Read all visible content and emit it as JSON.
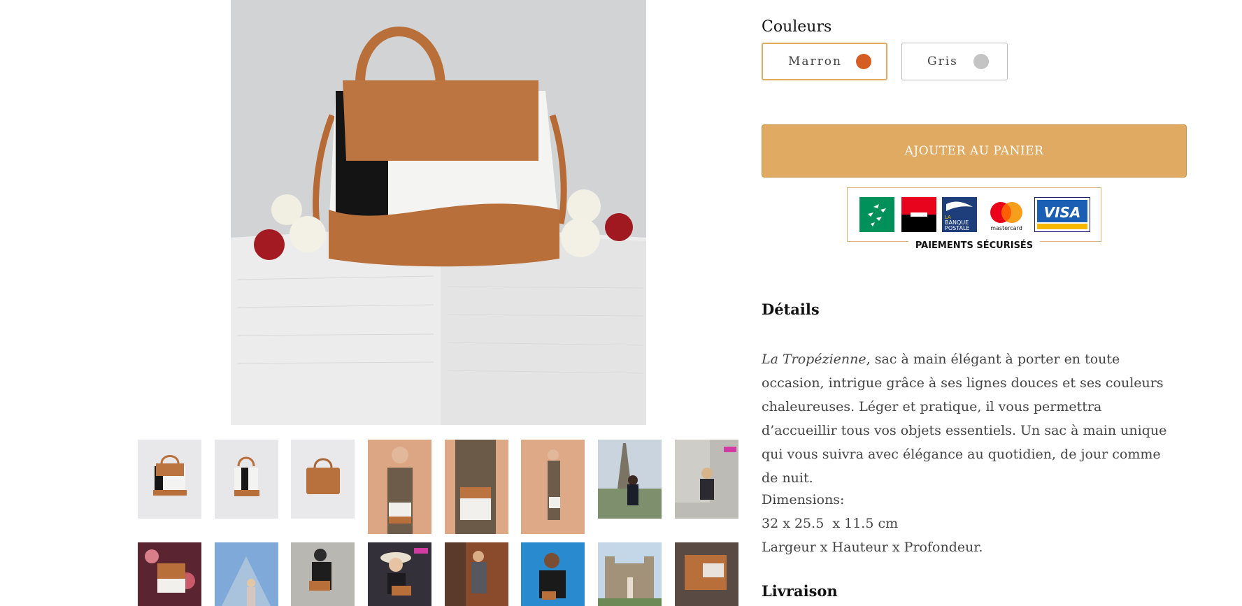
{
  "product": {
    "colors_title": "Couleurs",
    "color_options": [
      {
        "label": "Marron",
        "color": "#d35d22",
        "selected": true
      },
      {
        "label": "Gris",
        "color": "#c4c4c4",
        "selected": false
      }
    ],
    "add_to_cart_label": "AJOUTER AU PANIER",
    "payment_caption": "PAIEMENTS SÉCURISÉS",
    "payment_logos": [
      {
        "name": "bnp-paribas",
        "color": "#00915a"
      },
      {
        "name": "societe-generale",
        "color": "#e9041e"
      },
      {
        "name": "la-banque-postale",
        "text_line1": "LA",
        "text_line2": "BANQUE",
        "text_line3": "POSTALE",
        "color": "#1d3d7b"
      },
      {
        "name": "mastercard",
        "text": "mastercard"
      },
      {
        "name": "visa",
        "text": "VISA",
        "color": "#1a1f71"
      }
    ],
    "details_title": "Détails",
    "description_italic": "La Tropézienne",
    "description_rest": ", sac à main élégant à porter en toute occasion, intrigue grâce à ses lignes douces et ses couleurs chaleureuses. Léger et pratique, il vous permettra d’accueillir tous vos objets essentiels. Un sac à main unique qui vous suivra avec élégance au quotidien, de jour comme de nuit.",
    "dimensions_label": "Dimensions:",
    "dimensions_value": "32 x 25.5  x 11.5 cm",
    "dimensions_axes": "Largeur x Hauteur x Profondeur.",
    "delivery_title": "Livraison"
  },
  "gallery": {
    "main_image": "brown-white-black-handbag-on-pedestal",
    "thumbnails_row1": [
      "bag-front",
      "bag-side",
      "bag-brown-back",
      "model-tan-1",
      "model-tan-2",
      "model-tan-full",
      "eiffel-tower",
      "model-steps"
    ],
    "thumbnails_row2": [
      "model-floral",
      "louvre-pyramid",
      "model-bench",
      "model-car-hat",
      "model-street",
      "model-blue-sky",
      "castle",
      "bag-detail"
    ]
  }
}
